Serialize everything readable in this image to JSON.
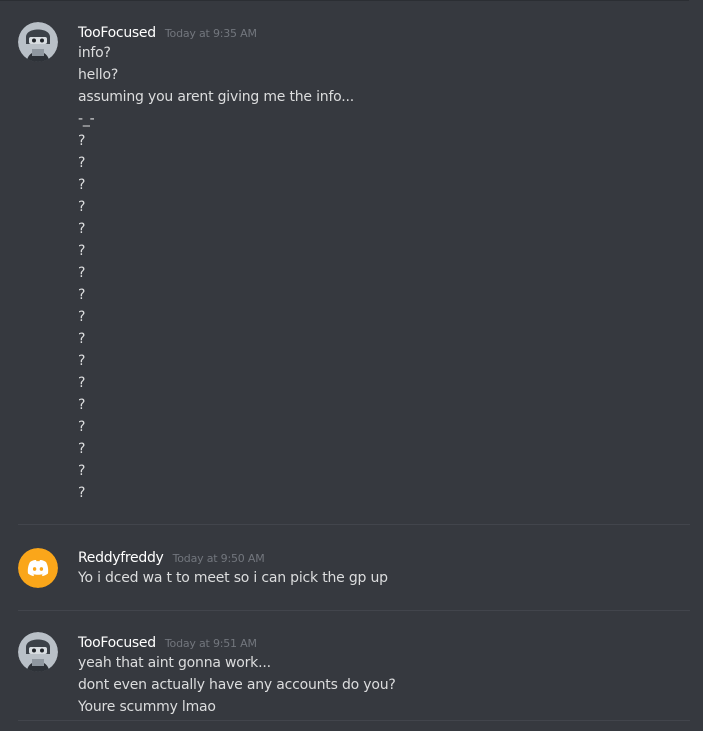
{
  "colors": {
    "background": "#36393f",
    "username": "#ffffff",
    "timestamp": "#72767d",
    "message_text": "#dcddde",
    "discord_default_avatar": "#faa61a"
  },
  "groups": [
    {
      "username": "TooFocused",
      "timestamp": "Today at 9:35 AM",
      "avatar_icon": "helmet-avatar-icon",
      "messages": [
        "info?",
        "hello?",
        "assuming you arent giving me the info...",
        "-_-",
        "?",
        "?",
        "?",
        "?",
        "?",
        "?",
        "?",
        "?",
        "?",
        "?",
        "?",
        "?",
        "?",
        "?",
        "?",
        "?",
        "?"
      ]
    },
    {
      "username": "Reddyfreddy",
      "timestamp": "Today at 9:50 AM",
      "avatar_icon": "discord-default-avatar-icon",
      "messages": [
        "Yo i dced wa t to meet so i can pick the gp up"
      ]
    },
    {
      "username": "TooFocused",
      "timestamp": "Today at 9:51 AM",
      "avatar_icon": "helmet-avatar-icon",
      "messages": [
        "yeah that aint gonna work...",
        "dont even actually have any accounts do you?",
        "Youre scummy lmao"
      ]
    }
  ]
}
